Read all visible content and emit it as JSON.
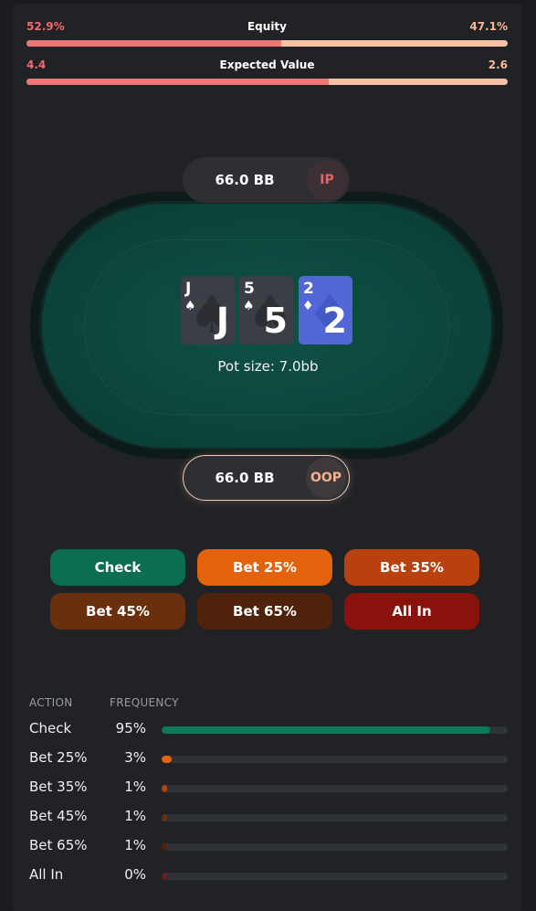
{
  "stats": {
    "equity": {
      "title": "Equity",
      "left": "52.9%",
      "right": "47.1%",
      "left_share": 0.529
    },
    "ev": {
      "title": "Expected Value",
      "left": "4.4",
      "right": "2.6",
      "left_share": 0.629
    }
  },
  "table": {
    "ip": {
      "stack": "66.0 BB",
      "position": "IP"
    },
    "oop": {
      "stack": "66.0 BB",
      "position": "OOP"
    },
    "board": [
      {
        "rank": "J",
        "suit": "♠",
        "suit_name": "spade"
      },
      {
        "rank": "5",
        "suit": "♠",
        "suit_name": "spade"
      },
      {
        "rank": "2",
        "suit": "♦",
        "suit_name": "diamond"
      }
    ],
    "pot": "Pot size: 7.0bb"
  },
  "actions": [
    {
      "label": "Check",
      "color": "#0b6e52"
    },
    {
      "label": "Bet 25%",
      "color": "#e3620c"
    },
    {
      "label": "Bet 35%",
      "color": "#b9410e"
    },
    {
      "label": "Bet 45%",
      "color": "#6a300d"
    },
    {
      "label": "Bet 65%",
      "color": "#4f220b"
    },
    {
      "label": "All In",
      "color": "#8a120c"
    }
  ],
  "frequency": {
    "headers": {
      "action": "ACTION",
      "frequency": "FREQUENCY"
    },
    "rows": [
      {
        "action": "Check",
        "pct": "95%",
        "value": 0.95,
        "color": "#0b7a5b"
      },
      {
        "action": "Bet 25%",
        "pct": "3%",
        "value": 0.03,
        "color": "#e3620c"
      },
      {
        "action": "Bet 35%",
        "pct": "1%",
        "value": 0.01,
        "color": "#b9410e"
      },
      {
        "action": "Bet 45%",
        "pct": "1%",
        "value": 0.01,
        "color": "#6a300d"
      },
      {
        "action": "Bet 65%",
        "pct": "1%",
        "value": 0.01,
        "color": "#4f220b"
      },
      {
        "action": "All In",
        "pct": "0%",
        "value": 0.0,
        "color": "#8a120c"
      }
    ]
  }
}
